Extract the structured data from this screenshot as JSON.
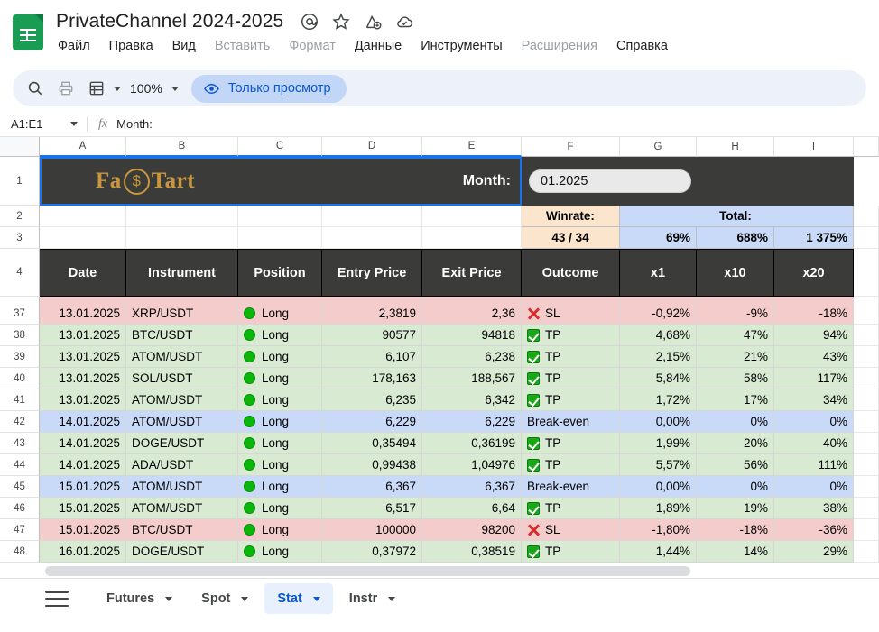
{
  "app": {
    "doc_title": "PrivateChannel 2024-2025",
    "doc_icon": "sheets-icon",
    "title_icons": [
      "at-icon",
      "star-icon",
      "move-to-drive-icon",
      "cloud-saved-icon"
    ],
    "menu": [
      {
        "label": "Файл",
        "dim": false
      },
      {
        "label": "Правка",
        "dim": false
      },
      {
        "label": "Вид",
        "dim": false
      },
      {
        "label": "Вставить",
        "dim": true
      },
      {
        "label": "Формат",
        "dim": true
      },
      {
        "label": "Данные",
        "dim": false
      },
      {
        "label": "Инструменты",
        "dim": false
      },
      {
        "label": "Расширения",
        "dim": true
      },
      {
        "label": "Справка",
        "dim": false
      }
    ]
  },
  "toolbar": {
    "search_icon": "search-icon",
    "print_icon": "print-icon",
    "sheet_icon": "spreadsheet-icon",
    "zoom_value": "100%",
    "view_only_label": "Только просмотр",
    "view_only_icon": "eye-icon"
  },
  "formula_bar": {
    "name_box": "A1:E1",
    "fx_symbol": "fx",
    "value": "Month:"
  },
  "grid": {
    "columns": [
      "A",
      "B",
      "C",
      "D",
      "E",
      "F",
      "G",
      "H",
      "I"
    ],
    "selected_columns": [
      "A",
      "B",
      "C",
      "D",
      "E"
    ],
    "banner": {
      "logo_left": "Fa",
      "logo_coin": "$",
      "logo_right": "Tart",
      "month_label": "Month:",
      "month_value": "01.2025"
    },
    "summary": {
      "winrate_label": "Winrate:",
      "total_label": "Total:",
      "winrate_value": "43 / 34",
      "x1_total": "69%",
      "x10_total": "688%",
      "x20_total": "1 375%"
    },
    "headers": [
      "Date",
      "Instrument",
      "Position",
      "Entry Price",
      "Exit Price",
      "Outcome",
      "x1",
      "x10",
      "x20"
    ],
    "row_numbers": [
      "1",
      "2",
      "3",
      "4",
      "37",
      "38",
      "39",
      "40",
      "41",
      "42",
      "43",
      "44",
      "45",
      "46",
      "47",
      "48"
    ],
    "rows": [
      {
        "n": "37",
        "date": "13.01.2025",
        "instrument": "XRP/USDT",
        "position": "Long",
        "entry": "2,3819",
        "exit": "2,36",
        "outcome": "SL",
        "mark": "sl",
        "x1": "-0,92%",
        "x10": "-9%",
        "x20": "-18%",
        "state": "sl"
      },
      {
        "n": "38",
        "date": "13.01.2025",
        "instrument": "BTC/USDT",
        "position": "Long",
        "entry": "90577",
        "exit": "94818",
        "outcome": "TP",
        "mark": "tp",
        "x1": "4,68%",
        "x10": "47%",
        "x20": "94%",
        "state": "tp"
      },
      {
        "n": "39",
        "date": "13.01.2025",
        "instrument": "ATOM/USDT",
        "position": "Long",
        "entry": "6,107",
        "exit": "6,238",
        "outcome": "TP",
        "mark": "tp",
        "x1": "2,15%",
        "x10": "21%",
        "x20": "43%",
        "state": "tp"
      },
      {
        "n": "40",
        "date": "13.01.2025",
        "instrument": "SOL/USDT",
        "position": "Long",
        "entry": "178,163",
        "exit": "188,567",
        "outcome": "TP",
        "mark": "tp",
        "x1": "5,84%",
        "x10": "58%",
        "x20": "117%",
        "state": "tp"
      },
      {
        "n": "41",
        "date": "13.01.2025",
        "instrument": "ATOM/USDT",
        "position": "Long",
        "entry": "6,235",
        "exit": "6,342",
        "outcome": "TP",
        "mark": "tp",
        "x1": "1,72%",
        "x10": "17%",
        "x20": "34%",
        "state": "tp"
      },
      {
        "n": "42",
        "date": "14.01.2025",
        "instrument": "ATOM/USDT",
        "position": "Long",
        "entry": "6,229",
        "exit": "6,229",
        "outcome": "Break-even",
        "mark": "",
        "x1": "0,00%",
        "x10": "0%",
        "x20": "0%",
        "state": "be"
      },
      {
        "n": "43",
        "date": "14.01.2025",
        "instrument": "DOGE/USDT",
        "position": "Long",
        "entry": "0,35494",
        "exit": "0,36199",
        "outcome": "TP",
        "mark": "tp",
        "x1": "1,99%",
        "x10": "20%",
        "x20": "40%",
        "state": "tp"
      },
      {
        "n": "44",
        "date": "14.01.2025",
        "instrument": "ADA/USDT",
        "position": "Long",
        "entry": "0,99438",
        "exit": "1,04976",
        "outcome": "TP",
        "mark": "tp",
        "x1": "5,57%",
        "x10": "56%",
        "x20": "111%",
        "state": "tp"
      },
      {
        "n": "45",
        "date": "15.01.2025",
        "instrument": "ATOM/USDT",
        "position": "Long",
        "entry": "6,367",
        "exit": "6,367",
        "outcome": "Break-even",
        "mark": "",
        "x1": "0,00%",
        "x10": "0%",
        "x20": "0%",
        "state": "be"
      },
      {
        "n": "46",
        "date": "15.01.2025",
        "instrument": "ATOM/USDT",
        "position": "Long",
        "entry": "6,517",
        "exit": "6,64",
        "outcome": "TP",
        "mark": "tp",
        "x1": "1,89%",
        "x10": "19%",
        "x20": "38%",
        "state": "tp"
      },
      {
        "n": "47",
        "date": "15.01.2025",
        "instrument": "BTC/USDT",
        "position": "Long",
        "entry": "100000",
        "exit": "98200",
        "outcome": "SL",
        "mark": "sl",
        "x1": "-1,80%",
        "x10": "-18%",
        "x20": "-36%",
        "state": "sl"
      },
      {
        "n": "48",
        "date": "16.01.2025",
        "instrument": "DOGE/USDT",
        "position": "Long",
        "entry": "0,37972",
        "exit": "0,38519",
        "outcome": "TP",
        "mark": "tp",
        "x1": "1,44%",
        "x10": "14%",
        "x20": "29%",
        "state": "tp"
      }
    ]
  },
  "sheet_tabs": [
    {
      "label": "Futures",
      "active": false
    },
    {
      "label": "Spot",
      "active": false
    },
    {
      "label": "Stat",
      "active": true
    },
    {
      "label": "Instr",
      "active": false
    }
  ],
  "colors": {
    "banner_bg": "#3b3b3a",
    "logo_gold": "#c8963c",
    "tp_green": "#d9ead3",
    "sl_red": "#f4cccc",
    "be_blue": "#c9daf8",
    "winrate_orange": "#fce5cd",
    "accent_blue": "#0b57d0"
  }
}
